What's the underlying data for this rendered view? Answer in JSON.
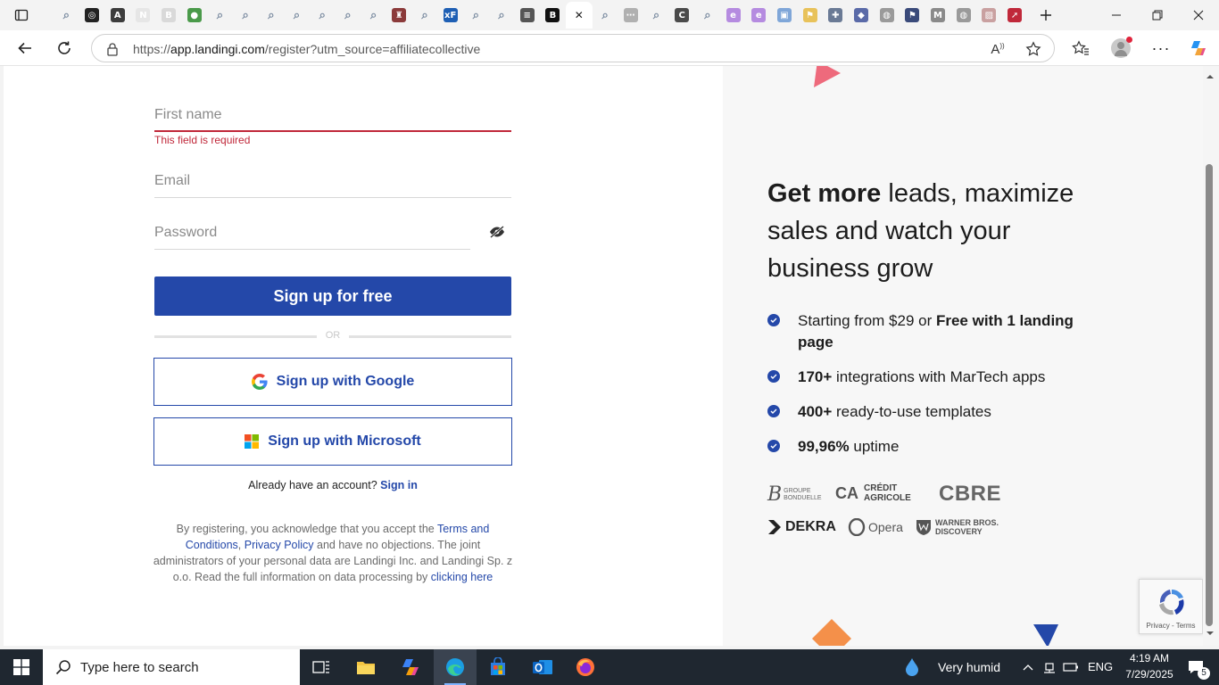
{
  "browser": {
    "url_prefix": "https://",
    "url_host": "app.landingi.com",
    "url_path": "/register?utm_source=affiliatecollective",
    "tabs": [
      {
        "icon": "search-tab-icon",
        "color": "#7a8ba0",
        "glyph": "⌕"
      },
      {
        "icon": "chatgpt-tab-icon",
        "color": "#222222",
        "glyph": "◎"
      },
      {
        "icon": "ai-tab-icon",
        "color": "#3c3c3c",
        "glyph": "A"
      },
      {
        "icon": "notion-tab-icon",
        "color": "#e6e6e6",
        "glyph": "N"
      },
      {
        "icon": "b-tab-icon",
        "color": "#d9d9d9",
        "glyph": "B"
      },
      {
        "icon": "globe-green-tab-icon",
        "color": "#4a9a4a",
        "glyph": "●"
      },
      {
        "icon": "search-tab-icon",
        "color": "#7a8ba0",
        "glyph": "⌕"
      },
      {
        "icon": "search-tab-icon",
        "color": "#7a8ba0",
        "glyph": "⌕"
      },
      {
        "icon": "search-tab-icon",
        "color": "#7a8ba0",
        "glyph": "⌕"
      },
      {
        "icon": "search-tab-icon",
        "color": "#7a8ba0",
        "glyph": "⌕"
      },
      {
        "icon": "search-tab-icon",
        "color": "#7a8ba0",
        "glyph": "⌕"
      },
      {
        "icon": "search-tab-icon",
        "color": "#7a8ba0",
        "glyph": "⌕"
      },
      {
        "icon": "search-tab-icon",
        "color": "#7a8ba0",
        "glyph": "⌕"
      },
      {
        "icon": "castle-tab-icon",
        "color": "#8b3a3a",
        "glyph": "♜"
      },
      {
        "icon": "search-tab-icon",
        "color": "#7a8ba0",
        "glyph": "⌕"
      },
      {
        "icon": "xf-tab-icon",
        "color": "#1e5fb4",
        "glyph": "xF"
      },
      {
        "icon": "search-tab-icon",
        "color": "#7a8ba0",
        "glyph": "⌕"
      },
      {
        "icon": "search-tab-icon",
        "color": "#7a8ba0",
        "glyph": "⌕"
      },
      {
        "icon": "stack-tab-icon",
        "color": "#555555",
        "glyph": "≡"
      },
      {
        "icon": "bold-b-tab-icon",
        "color": "#111111",
        "glyph": "B"
      },
      {
        "icon": "active-tab-close-icon",
        "color": "#ffffff",
        "glyph": "✕"
      },
      {
        "icon": "search-tab-icon",
        "color": "#7a8ba0",
        "glyph": "⌕"
      },
      {
        "icon": "dots-tab-icon",
        "color": "#b0b0b0",
        "glyph": "⋯"
      },
      {
        "icon": "search-tab-icon",
        "color": "#7a8ba0",
        "glyph": "⌕"
      },
      {
        "icon": "c-tab-icon",
        "color": "#4a4a4a",
        "glyph": "C"
      },
      {
        "icon": "search-tab-icon",
        "color": "#7a8ba0",
        "glyph": "⌕"
      },
      {
        "icon": "copilot-tab-icon",
        "color": "#b58be0",
        "glyph": "e"
      },
      {
        "icon": "copilot-tab-icon",
        "color": "#b58be0",
        "glyph": "e"
      },
      {
        "icon": "image-tab-icon",
        "color": "#7fa6d8",
        "glyph": "▣"
      },
      {
        "icon": "yellow-tab-icon",
        "color": "#e8c25a",
        "glyph": "⚑"
      },
      {
        "icon": "puzzle-tab-icon",
        "color": "#6a7a95",
        "glyph": "✚"
      },
      {
        "icon": "shape-tab-icon",
        "color": "#5a6aa8",
        "glyph": "◆"
      },
      {
        "icon": "globe-tab-icon",
        "color": "#9a9a9a",
        "glyph": "◍"
      },
      {
        "icon": "flag-tab-icon",
        "color": "#3a4a7a",
        "glyph": "⚑"
      },
      {
        "icon": "m-tab-icon",
        "color": "#8a8a8a",
        "glyph": "M"
      },
      {
        "icon": "globe-tab-icon",
        "color": "#9a9a9a",
        "glyph": "◍"
      },
      {
        "icon": "stripes-tab-icon",
        "color": "#c9a0a0",
        "glyph": "▨"
      },
      {
        "icon": "red-arrow-tab-icon",
        "color": "#c0283a",
        "glyph": "➚"
      }
    ]
  },
  "form": {
    "first_name_placeholder": "First name",
    "first_name_error": "This field is required",
    "email_placeholder": "Email",
    "password_placeholder": "Password",
    "submit_label": "Sign up for free",
    "or_label": "OR",
    "google_label": "Sign up with Google",
    "microsoft_label": "Sign up with Microsoft",
    "have_account": "Already have an account?",
    "sign_in": "Sign in",
    "legal_1": "By registering, you acknowledge that you accept the ",
    "terms": "Terms and Conditions",
    "comma": ", ",
    "privacy": "Privacy Policy",
    "legal_2": " and have no objections. The joint administrators of your personal data are Landingi Inc. and Landingi Sp. z o.o. Read the full information on data processing by ",
    "clicking_here": "clicking here"
  },
  "promo": {
    "headline_bold": "Get more",
    "headline_rest": " leads, maximize sales and watch your business grow",
    "features": [
      {
        "pre": "Starting from $29 or ",
        "bold": "Free with 1 landing page",
        "post": ""
      },
      {
        "pre": "",
        "bold": "170+",
        "post": " integrations with MarTech apps"
      },
      {
        "pre": "",
        "bold": "400+",
        "post": " ready-to-use templates"
      },
      {
        "pre": "",
        "bold": "99,96%",
        "post": " uptime"
      }
    ],
    "logos": {
      "bonduelle": "GROUPE BONDUELLE",
      "credit_agricole_1": "CRÉDIT",
      "credit_agricole_2": "AGRICOLE",
      "cbre": "CBRE",
      "dekra": "DEKRA",
      "opera": "Opera",
      "wb_1": "WARNER BROS.",
      "wb_2": "DISCOVERY"
    }
  },
  "recaptcha": {
    "text": "Privacy - Terms"
  },
  "taskbar": {
    "search_placeholder": "Type here to search",
    "weather": "Very humid",
    "lang": "ENG",
    "time": "4:19 AM",
    "date": "7/29/2025",
    "notifications": "5"
  },
  "colors": {
    "brand_blue": "#2448a9",
    "error_red": "#c0283a"
  }
}
